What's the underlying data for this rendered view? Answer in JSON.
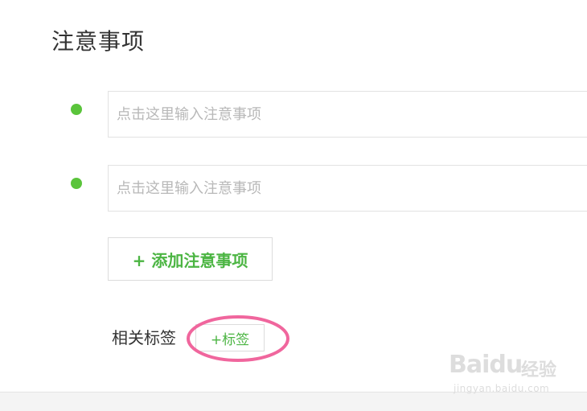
{
  "section": {
    "title": "注意事项"
  },
  "notes": [
    {
      "placeholder": "点击这里输入注意事项"
    },
    {
      "placeholder": "点击这里输入注意事项"
    }
  ],
  "add_note_button": {
    "label": "+ 添加注意事项"
  },
  "tags": {
    "label": "相关标签",
    "add_tag_label": "+标签"
  },
  "watermark": {
    "logo_text": "Baidu",
    "logo_suffix": "经验",
    "url": "jingyan.baidu.com"
  },
  "colors": {
    "bullet_green": "#5ac43b",
    "accent_green": "#4cb543",
    "highlight_pink": "#f0669d",
    "watermark_gray": "#dddddd"
  },
  "icons": {
    "bullet": "green-dot-icon",
    "highlight": "pink-ellipse-annotation"
  }
}
